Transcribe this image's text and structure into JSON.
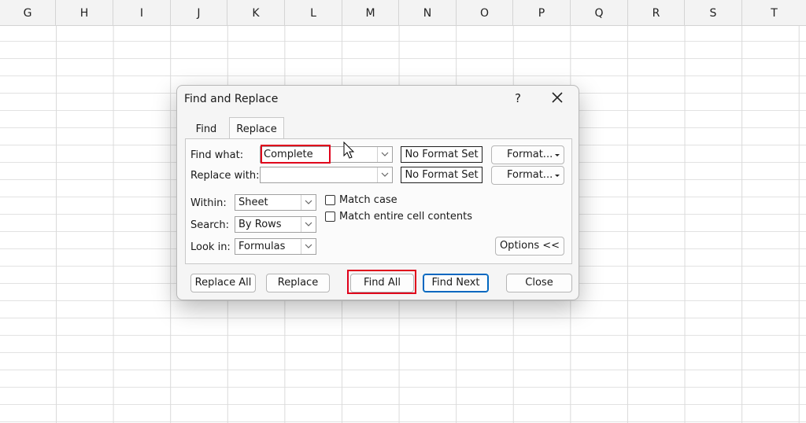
{
  "sheet": {
    "columns": [
      "G",
      "H",
      "I",
      "J",
      "K",
      "L",
      "M",
      "N",
      "O",
      "P",
      "Q",
      "R",
      "S",
      "T"
    ]
  },
  "dialog": {
    "title": "Find and Replace",
    "help_label": "?",
    "tabs": {
      "find": "Find",
      "replace": "Replace"
    },
    "find_what": {
      "label": "Find what:",
      "value": "Complete"
    },
    "replace_with": {
      "label": "Replace with:",
      "value": ""
    },
    "no_format_set": "No Format Set",
    "format_label": "Format...",
    "within": {
      "label": "Within:",
      "value": "Sheet"
    },
    "search": {
      "label": "Search:",
      "value": "By Rows"
    },
    "look_in": {
      "label": "Look in:",
      "value": "Formulas"
    },
    "match_case": {
      "label": "Match case",
      "checked": false
    },
    "match_entire": {
      "label": "Match entire cell contents",
      "checked": false
    },
    "options_label": "Options <<",
    "buttons": {
      "replace_all": "Replace All",
      "replace": "Replace",
      "find_all": "Find All",
      "find_next": "Find Next",
      "close": "Close"
    },
    "highlight_color": "#e0001b",
    "accent_color": "#0067c0"
  }
}
